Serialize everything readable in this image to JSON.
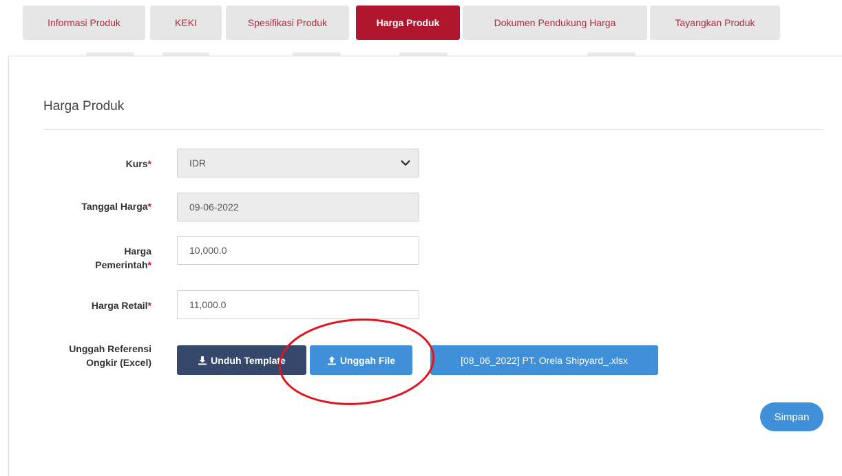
{
  "tabs": [
    {
      "label": "Informasi Produk",
      "active": false
    },
    {
      "label": "KEKI",
      "active": false
    },
    {
      "label": "Spesifikasi Produk",
      "active": false
    },
    {
      "label": "Harga Produk",
      "active": true
    },
    {
      "label": "Dokumen Pendukung Harga",
      "active": false
    },
    {
      "label": "Tayangkan Produk",
      "active": false
    }
  ],
  "section": {
    "title": "Harga Produk"
  },
  "form": {
    "kurs": {
      "label": "Kurs",
      "required_mark": "*",
      "value": "IDR"
    },
    "tanggal_harga": {
      "label": "Tanggal Harga",
      "required_mark": "*",
      "value": "09-06-2022"
    },
    "harga_pemerintah": {
      "label_line1": "Harga",
      "label_line2": "Pemerintah",
      "required_mark": "*",
      "value": "10,000.0"
    },
    "harga_retail": {
      "label": "Harga Retail",
      "required_mark": "*",
      "value": "11,000.0"
    },
    "unggah": {
      "label_line1": "Unggah Referensi",
      "label_line2": "Ongkir (Excel)"
    }
  },
  "buttons": {
    "unduh_template": "Unduh Template",
    "unggah_file": "Unggah File",
    "file_name": "[08_06_2022] PT. Orela Shipyard_.xlsx",
    "simpan": "Simpan"
  },
  "colors": {
    "accent": "#b0172f",
    "primary_blue": "#3f8fd9",
    "dark_button": "#35486b",
    "annotation_circle": "#e0141e"
  }
}
